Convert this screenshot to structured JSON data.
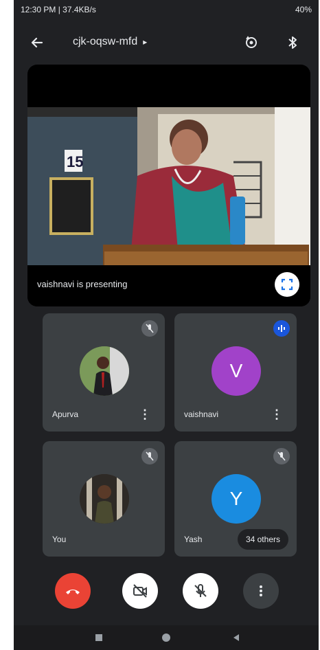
{
  "status_bar": {
    "time_text": "12:30 PM | 37.4KB/s",
    "battery_text": "40%"
  },
  "header": {
    "meeting_code": "cjk-oqsw-mfd",
    "icons": [
      "back-arrow-icon",
      "chevron-right-icon",
      "switch-camera-icon",
      "bluetooth-icon"
    ]
  },
  "stage": {
    "presenting_text": "vaishnavi is presenting",
    "room_number": "15"
  },
  "participants": [
    {
      "name": "Apurva",
      "muted": true,
      "avatar_type": "photo"
    },
    {
      "name": "vaishnavi",
      "muted": false,
      "speaking": true,
      "initial": "V",
      "color": "#a142c9"
    },
    {
      "name": "You",
      "muted": true,
      "avatar_type": "photo"
    },
    {
      "name": "Yash",
      "muted": true,
      "initial": "Y",
      "color": "#1a8ce0"
    }
  ],
  "others_label": "34 others",
  "controls": {
    "icons": [
      "end-call-icon",
      "camera-off-icon",
      "mic-off-icon",
      "more-options-icon"
    ],
    "end_call_color": "#ea4335"
  },
  "nav": {
    "icons": [
      "recents-icon",
      "home-icon",
      "back-icon"
    ]
  }
}
